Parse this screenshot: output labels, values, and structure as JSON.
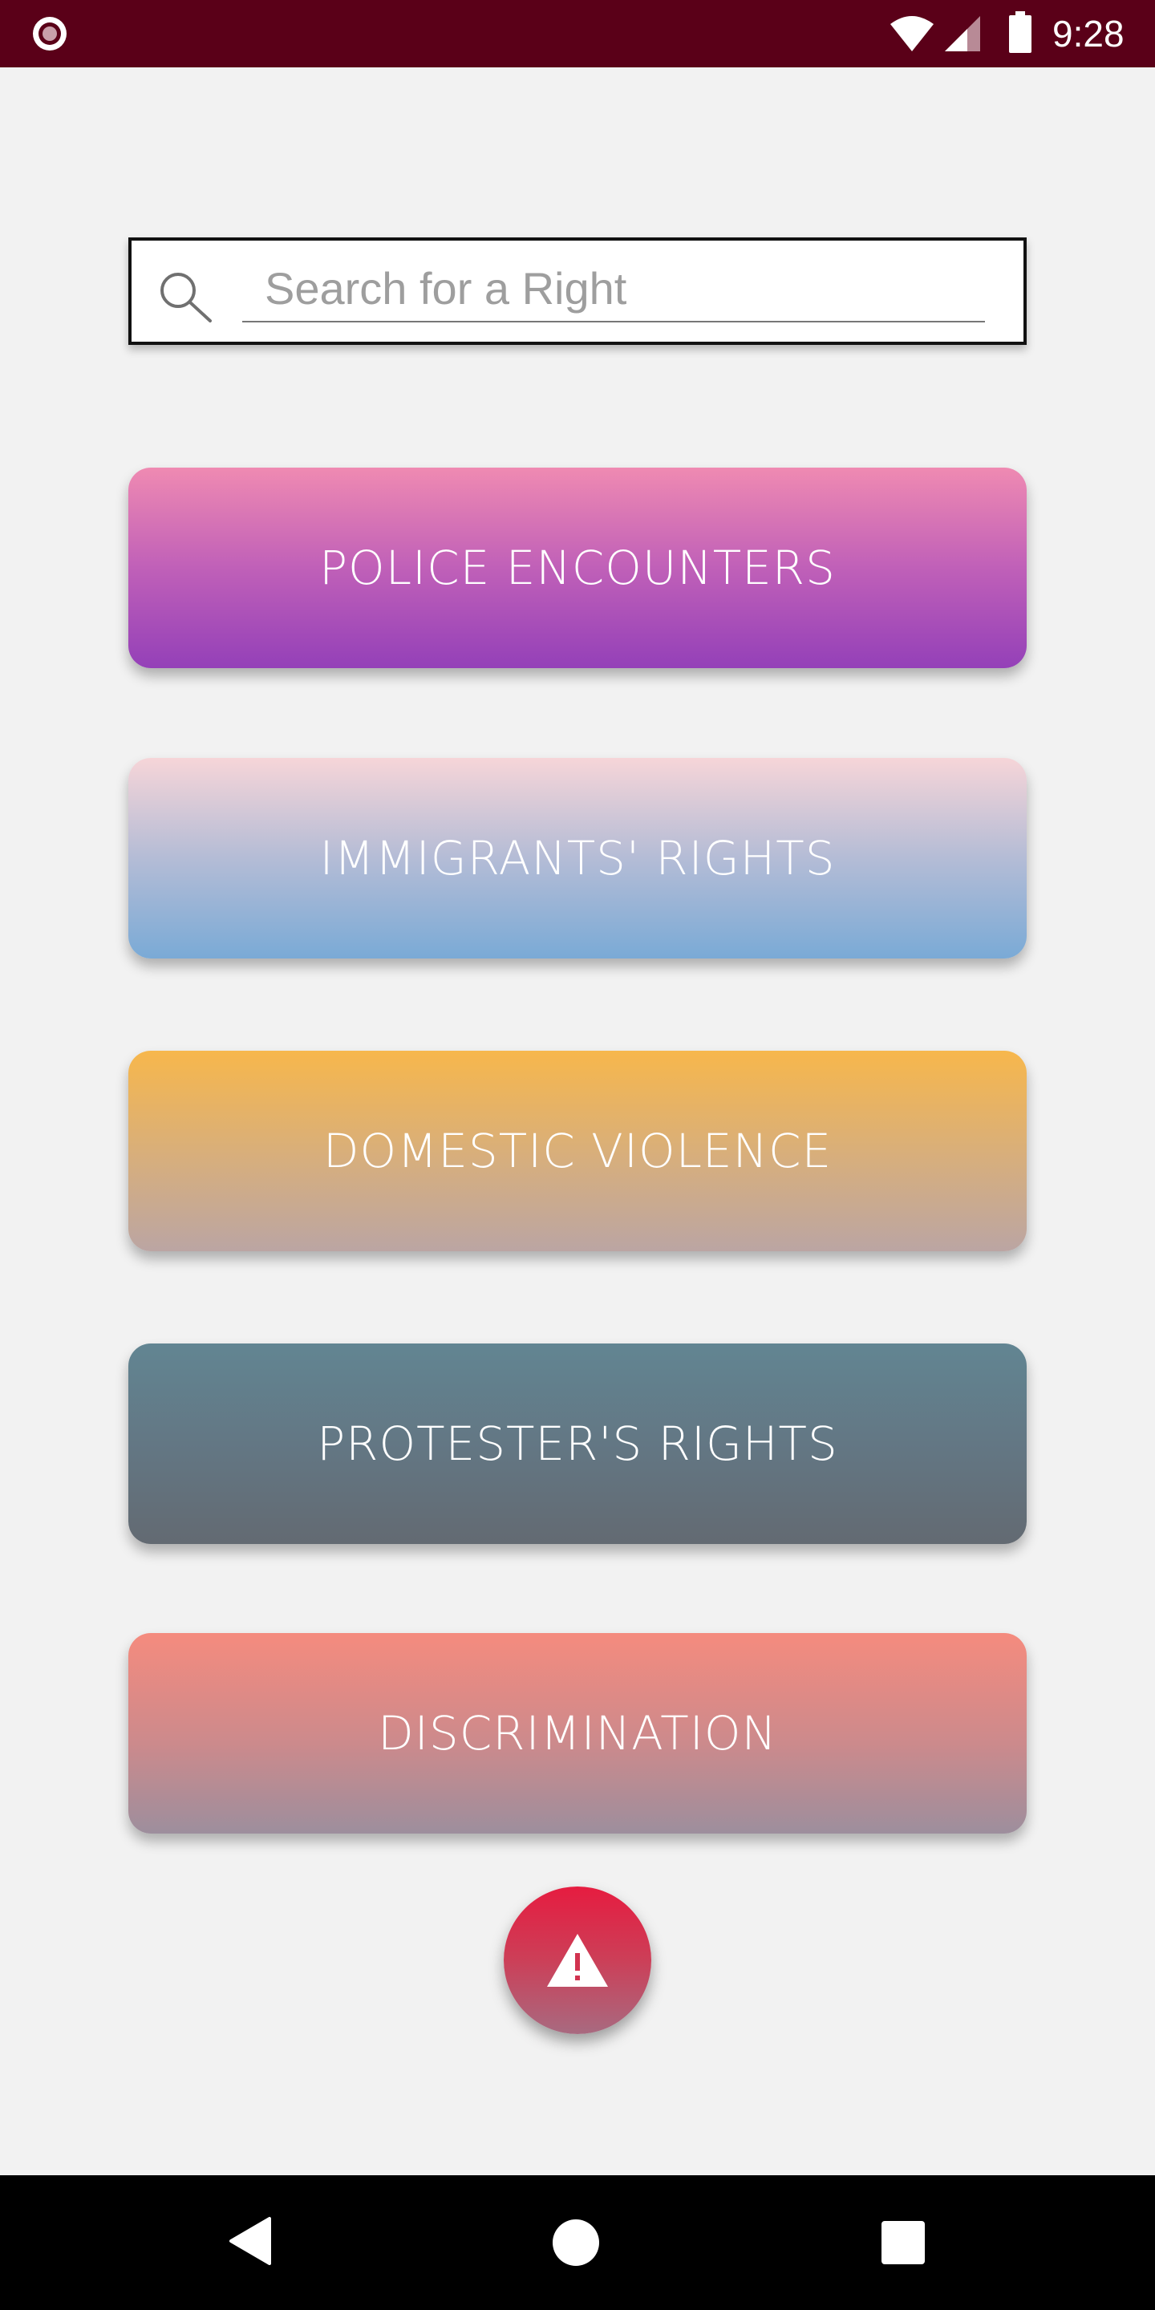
{
  "status_bar": {
    "time": "9:28",
    "app_icon": "circle-record-icon",
    "wifi_icon": "wifi-icon",
    "signal_icon": "cell-signal-icon",
    "battery_icon": "battery-icon",
    "background_color": "#5a0018"
  },
  "search": {
    "placeholder": "Search for a Right",
    "value": "",
    "icon": "search-icon"
  },
  "categories": [
    {
      "label": "POLICE ENCOUNTERS",
      "colors": [
        "#ef8ab2",
        "#9440b8"
      ]
    },
    {
      "label": "IMMIGRANTS' RIGHTS",
      "colors": [
        "#f6d5d8",
        "#7aaad6"
      ]
    },
    {
      "label": "DOMESTIC VIOLENCE",
      "colors": [
        "#f7b74c",
        "#bba5a3"
      ]
    },
    {
      "label": "PROTESTER'S RIGHTS",
      "colors": [
        "#628592",
        "#636a72"
      ]
    },
    {
      "label": "DISCRIMINATION",
      "colors": [
        "#f58b7e",
        "#9d8e9d"
      ]
    }
  ],
  "fab": {
    "icon": "warning-icon",
    "color": "#e61c40"
  },
  "nav_bar": {
    "back_icon": "back-triangle-icon",
    "home_icon": "home-circle-icon",
    "recents_icon": "recents-square-icon"
  }
}
